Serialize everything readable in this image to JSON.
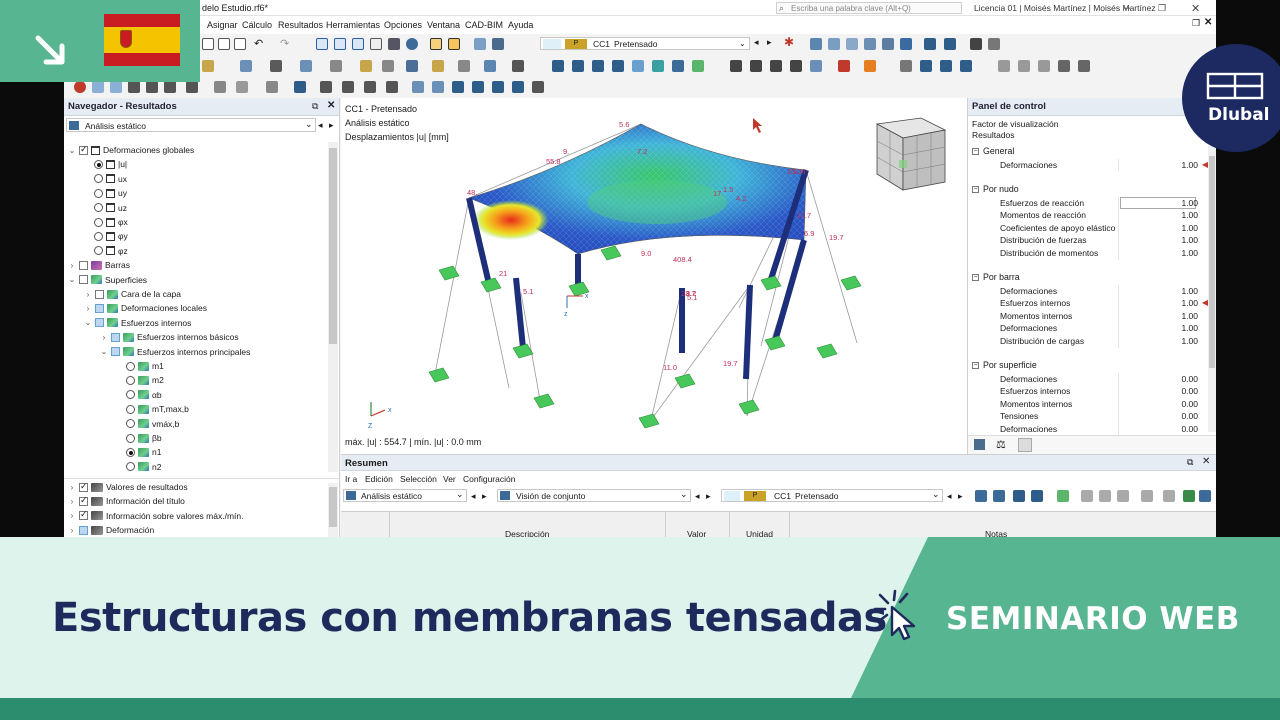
{
  "window": {
    "title": "delo Estudio.rf6*",
    "search_placeholder": "Escriba una palabra clave (Alt+Q)",
    "license": "Licencia 01 | Moisés Martínez | Moisés Martínez"
  },
  "menu": [
    "Asignar",
    "Cálculo",
    "Resultados",
    "Herramientas",
    "Opciones",
    "Ventana",
    "CAD-BIM",
    "Ayuda"
  ],
  "toolbar": {
    "loadcase_tag": "P",
    "loadcase_code": "CC1",
    "loadcase_name": "Pretensado"
  },
  "navigator": {
    "title": "Navegador - Resultados",
    "dropdown": "Análisis estático",
    "items": [
      {
        "label": "Deformaciones globales",
        "level": 0
      },
      {
        "label": "|u|",
        "level": 2
      },
      {
        "label": "ux",
        "level": 2
      },
      {
        "label": "uy",
        "level": 2
      },
      {
        "label": "uz",
        "level": 2
      },
      {
        "label": "φx",
        "level": 2
      },
      {
        "label": "φy",
        "level": 2
      },
      {
        "label": "φz",
        "level": 2
      },
      {
        "label": "Barras",
        "level": 0
      },
      {
        "label": "Superficies",
        "level": 0
      },
      {
        "label": "Cara de la capa",
        "level": 1
      },
      {
        "label": "Deformaciones locales",
        "level": 1
      },
      {
        "label": "Esfuerzos internos",
        "level": 1
      },
      {
        "label": "Esfuerzos internos básicos",
        "level": 2
      },
      {
        "label": "Esfuerzos internos principales",
        "level": 2
      },
      {
        "label": "m1",
        "level": 3
      },
      {
        "label": "m2",
        "level": 3
      },
      {
        "label": "αb",
        "level": 3
      },
      {
        "label": "mT,max,b",
        "level": 3
      },
      {
        "label": "vmáx,b",
        "level": 3
      },
      {
        "label": "βb",
        "level": 3
      },
      {
        "label": "n1",
        "level": 3
      },
      {
        "label": "n2",
        "level": 3
      }
    ],
    "bottom_items": [
      "Valores de resultados",
      "Información del título",
      "Información sobre valores máx./mín.",
      "Deformación"
    ]
  },
  "viewport": {
    "line1": "CC1 - Pretensado",
    "line2": "Análisis estático",
    "line3": "Desplazamientos |u| [mm]",
    "footer": "máx. |u| : 554.7 | mín. |u| : 0.0 mm",
    "labels": [
      "5.6",
      "55.8",
      "48.",
      "9.",
      "25.",
      "17.",
      "7.2",
      "1.5",
      "408.4",
      "4.2",
      "21",
      "5.1",
      "23.7",
      "5.1",
      "11.7",
      "6.9",
      "19.7",
      "8.2",
      "19.7",
      "11.0",
      "104",
      "9.0"
    ]
  },
  "control_panel": {
    "title": "Panel de control",
    "sub1": "Factor de visualización",
    "sub2": "Resultados",
    "groups": [
      {
        "name": "General",
        "rows": [
          {
            "label": "Deformaciones",
            "value": "1.00"
          }
        ]
      },
      {
        "name": "Por nudo",
        "rows": [
          {
            "label": "Esfuerzos de reacción",
            "value": "1.00"
          },
          {
            "label": "Momentos de reacción",
            "value": "1.00"
          },
          {
            "label": "Coeficientes de apoyo elástico",
            "value": "1.00"
          },
          {
            "label": "Distribución de fuerzas",
            "value": "1.00"
          },
          {
            "label": "Distribución de momentos",
            "value": "1.00"
          }
        ]
      },
      {
        "name": "Por barra",
        "rows": [
          {
            "label": "Deformaciones",
            "value": "1.00"
          },
          {
            "label": "Esfuerzos internos",
            "value": "1.00"
          },
          {
            "label": "Momentos internos",
            "value": "1.00"
          },
          {
            "label": "Deformaciones",
            "value": "1.00"
          },
          {
            "label": "Distribución de cargas",
            "value": "1.00"
          }
        ]
      },
      {
        "name": "Por superficie",
        "rows": [
          {
            "label": "Deformaciones",
            "value": "0.00"
          },
          {
            "label": "Esfuerzos internos",
            "value": "0.00"
          },
          {
            "label": "Momentos internos",
            "value": "0.00"
          },
          {
            "label": "Tensiones",
            "value": "0.00"
          },
          {
            "label": "Deformaciones",
            "value": "0.00"
          }
        ]
      }
    ]
  },
  "summary": {
    "title": "Resumen",
    "menu": [
      "Ir a",
      "Edición",
      "Selección",
      "Ver",
      "Configuración"
    ],
    "dropdown1": "Análisis estático",
    "dropdown2": "Visión de conjunto",
    "lc_tag": "P",
    "lc_code": "CC1",
    "lc_name": "Pretensado",
    "columns": [
      "Descripción",
      "Valor",
      "Unidad",
      "Notas"
    ]
  },
  "banner": {
    "title": "Estructuras con membranas tensadas",
    "tag": "SEMINARIO WEB",
    "brand": "Dlubal"
  },
  "colors": {
    "accent": "#58b591",
    "navy": "#1f2a5c",
    "dark_green": "#2b8d6d",
    "light_bg": "#ddf3ec"
  }
}
